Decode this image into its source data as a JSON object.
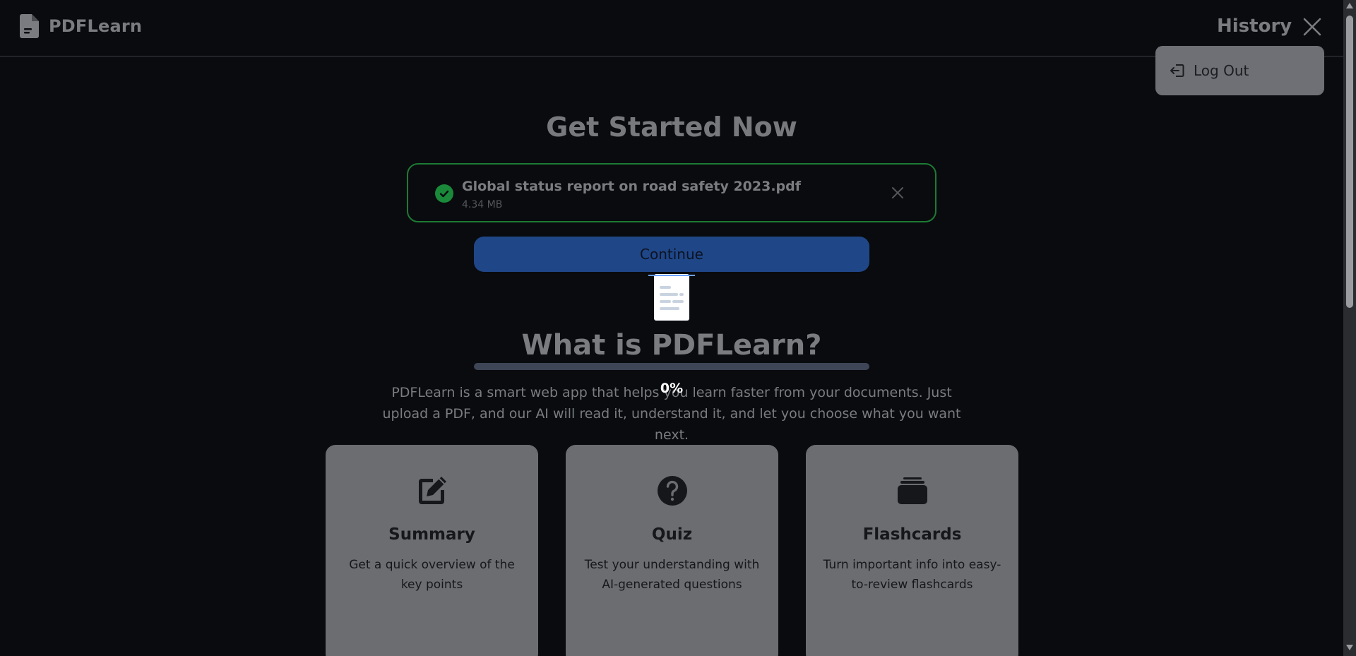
{
  "header": {
    "brand": "PDFLearn",
    "history_label": "History"
  },
  "user_menu": {
    "logout_label": "Log Out"
  },
  "upload": {
    "heading": "Get Started Now",
    "file_name": "Global status report on road safety 2023.pdf",
    "file_size": "4.34 MB",
    "continue_label": "Continue"
  },
  "progress": {
    "value_percent": 0,
    "label": "0%"
  },
  "about": {
    "heading": "What is PDFLearn?",
    "description": "PDFLearn is a smart web app that helps you learn faster from your documents. Just upload a PDF, and our AI will read it, understand it, and let you choose what you want next."
  },
  "features": [
    {
      "icon": "edit-icon",
      "title": "Summary",
      "description": "Get a quick overview of the key points"
    },
    {
      "icon": "question-circle-icon",
      "title": "Quiz",
      "description": "Test your understanding with AI-generated questions"
    },
    {
      "icon": "stack-icon",
      "title": "Flashcards",
      "description": "Turn important info into easy-to-review flashcards"
    }
  ],
  "colors": {
    "background": "#0a0b0e",
    "success": "#1d7a34",
    "primary_button": "#1f4788",
    "card": "#6b6d71"
  }
}
